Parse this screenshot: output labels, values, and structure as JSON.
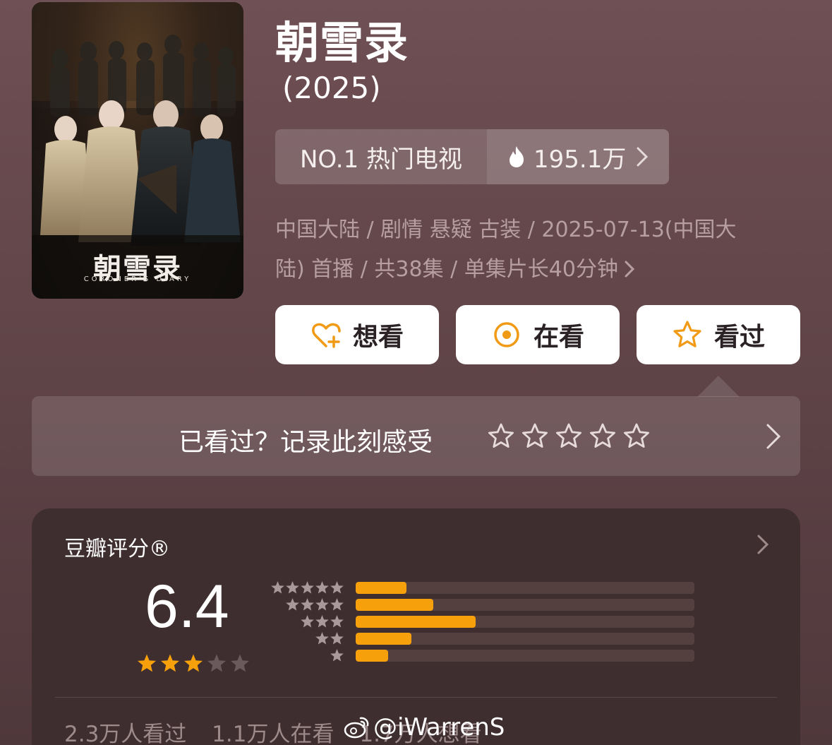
{
  "poster": {
    "title_art": "朝雪录",
    "subtitle_art": "CORONER'S DIARY"
  },
  "title": "朝雪录",
  "year": "(2025)",
  "rank": {
    "label": "NO.1 热门电视",
    "heat": "195.1万"
  },
  "meta": {
    "line1": "中国大陆 / 剧情 悬疑 古装 / 2025-07-13(中国大",
    "line2": "陆) 首播 / 共38集 / 单集片长40分钟"
  },
  "actions": {
    "want": "想看",
    "watching": "在看",
    "watched": "看过"
  },
  "review_prompt": "已看过？记录此刻感受",
  "rating": {
    "label": "豆瓣评分®",
    "score": "6.4",
    "stars_filled": 3,
    "stars_total": 5,
    "distribution": [
      {
        "stars": 5,
        "fraction": 0.15
      },
      {
        "stars": 4,
        "fraction": 0.23
      },
      {
        "stars": 3,
        "fraction": 0.355
      },
      {
        "stars": 2,
        "fraction": 0.165
      },
      {
        "stars": 1,
        "fraction": 0.095
      }
    ]
  },
  "stats": {
    "watched": "2.3万人看过",
    "watching": "1.1万人在看",
    "want": "1.7万人想看"
  },
  "watermark": "@iWarrenS",
  "colors": {
    "accent": "#f6a00c",
    "background": "#624649",
    "card": "#3f2e30"
  }
}
